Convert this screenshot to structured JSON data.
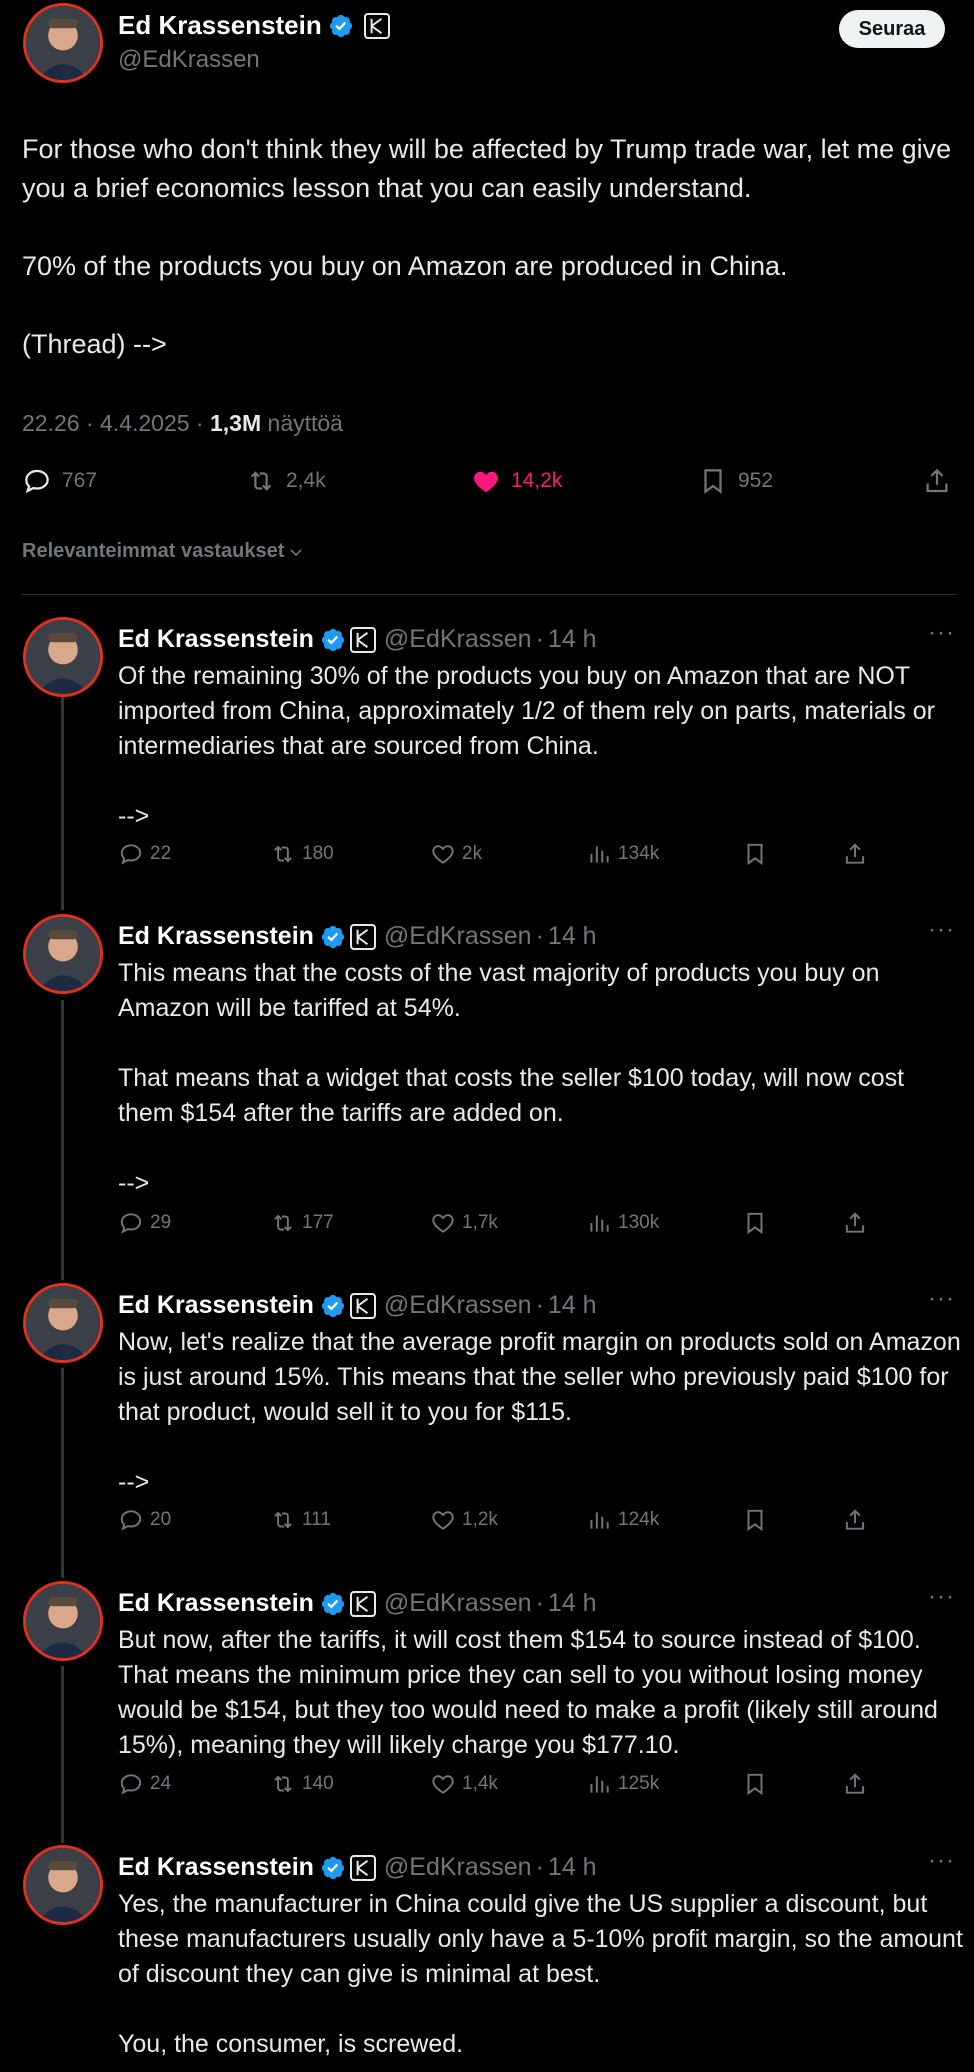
{
  "author": {
    "name": "Ed Krassenstein",
    "handle": "@EdKrassen"
  },
  "follow_label": "Seuraa",
  "main_tweet": {
    "paragraphs": [
      "For those who don't think they will be affected by Trump trade war, let me give you a brief economics lesson that you can easily understand.",
      "70% of the products you buy on Amazon are produced in China.",
      "(Thread) -->"
    ],
    "meta": {
      "time": "22.26",
      "date": "4.4.2025",
      "views_count": "1,3M",
      "views_label": "näyttöä"
    },
    "stats": {
      "replies": "767",
      "reposts": "2,4k",
      "likes": "14,2k",
      "bookmarks": "952"
    }
  },
  "sort_label": "Relevanteimmat vastaukset",
  "replies": [
    {
      "time": "14 h",
      "paragraphs": [
        "Of the remaining 30% of the products you buy on Amazon that are NOT imported from China, approximately 1/2 of them rely on parts, materials or intermediaries that are sourced from China.",
        "",
        "-->"
      ],
      "stats": {
        "replies": "22",
        "reposts": "180",
        "likes": "2k",
        "views": "134k"
      }
    },
    {
      "time": "14 h",
      "paragraphs": [
        "This means that the costs of the vast majority of products you buy on Amazon will be tariffed at 54%.",
        "That means that a widget that costs the seller $100 today, will now cost them $154 after the tariffs are added on.",
        "",
        "-->"
      ],
      "stats": {
        "replies": "29",
        "reposts": "177",
        "likes": "1,7k",
        "views": "130k"
      }
    },
    {
      "time": "14 h",
      "paragraphs": [
        "Now, let's realize that the average profit margin on products sold on Amazon is just around 15%. This means that the seller who previously paid $100 for that product, would sell it to you for $115.",
        "",
        "-->"
      ],
      "stats": {
        "replies": "20",
        "reposts": "111",
        "likes": "1,2k",
        "views": "124k"
      }
    },
    {
      "time": "14 h",
      "paragraphs": [
        "But now, after the tariffs, it will cost them $154 to source instead of $100.  That means the minimum price they can sell to you without losing money would be $154, but they too would need to make a profit (likely still around 15%), meaning they will likely charge you $177.10."
      ],
      "stats": {
        "replies": "24",
        "reposts": "140",
        "likes": "1,4k",
        "views": "125k"
      }
    },
    {
      "time": "14 h",
      "paragraphs": [
        "Yes, the manufacturer in China could give the US supplier a discount, but these manufacturers usually only have a 5-10% profit margin, so the amount of discount they can give is minimal at best.",
        "You, the consumer, is screwed."
      ],
      "stats": null
    }
  ],
  "icons": {
    "verified": "verified-badge-icon",
    "affiliate": "k-affiliate-icon",
    "reply": "reply-icon",
    "repost": "repost-icon",
    "like": "heart-icon",
    "views": "views-icon",
    "bookmark": "bookmark-icon",
    "share": "share-icon",
    "more": "more-icon"
  },
  "colors": {
    "background": "#000000",
    "text": "#e7e9ea",
    "secondary": "#71767b",
    "like": "#f91880",
    "verified": "#1d9bf0",
    "avatar_ring": "#e0301e"
  }
}
